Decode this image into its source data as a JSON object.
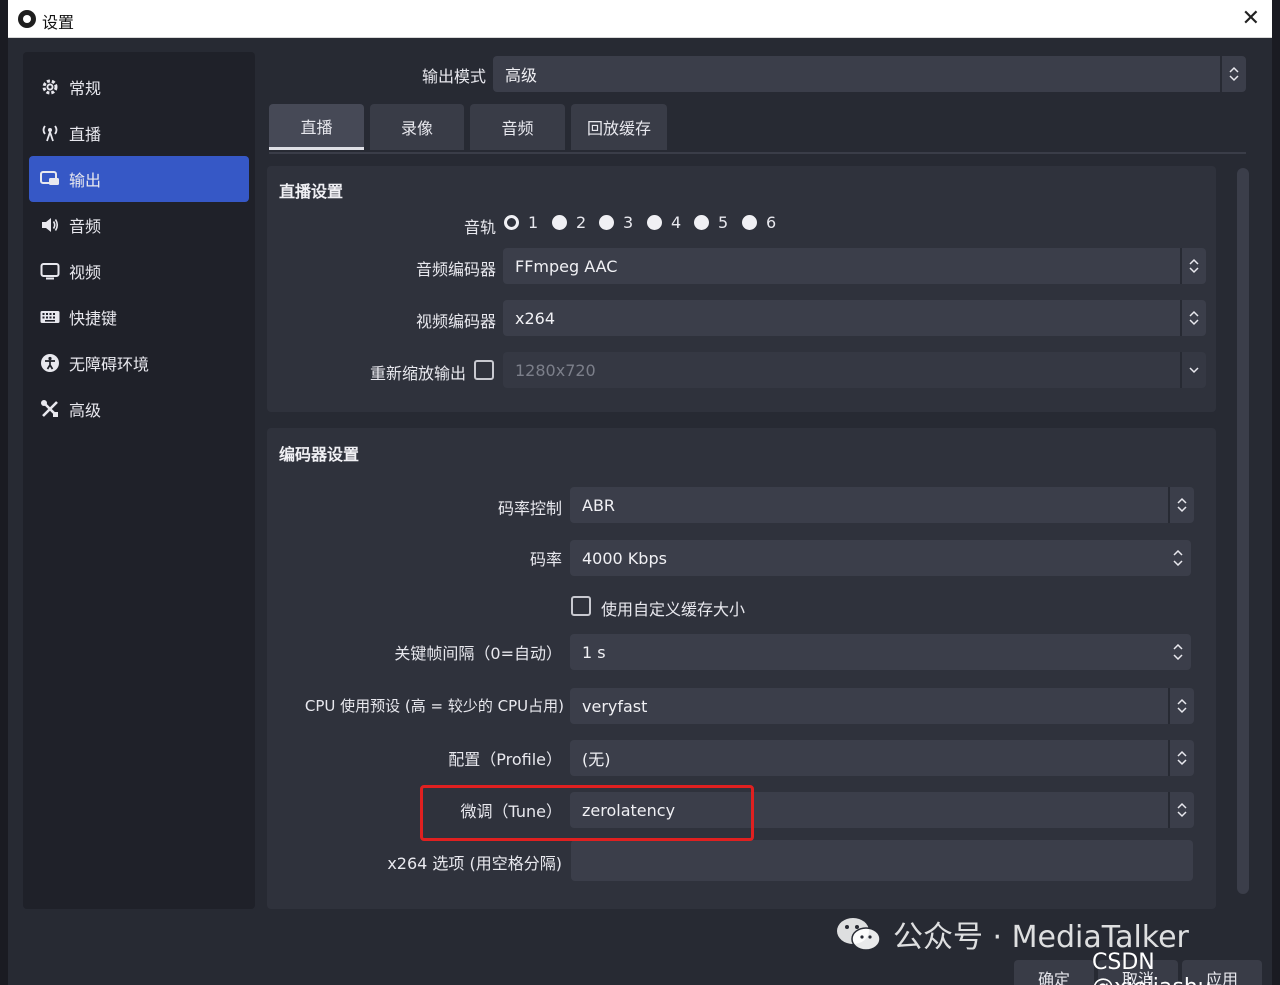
{
  "window": {
    "title": "设置"
  },
  "sidebar": {
    "items": [
      {
        "label": "常规",
        "icon": "gear-icon"
      },
      {
        "label": "直播",
        "icon": "broadcast-icon"
      },
      {
        "label": "输出",
        "icon": "output-icon",
        "active": true
      },
      {
        "label": "音频",
        "icon": "speaker-icon"
      },
      {
        "label": "视频",
        "icon": "monitor-icon"
      },
      {
        "label": "快捷键",
        "icon": "keyboard-icon"
      },
      {
        "label": "无障碍环境",
        "icon": "accessibility-icon"
      },
      {
        "label": "高级",
        "icon": "wrench-icon"
      }
    ]
  },
  "output_mode": {
    "label": "输出模式",
    "value": "高级"
  },
  "tabs": [
    "直播",
    "录像",
    "音频",
    "回放缓存"
  ],
  "stream_group": {
    "title": "直播设置",
    "audio_track_label": "音轨",
    "tracks": [
      "1",
      "2",
      "3",
      "4",
      "5",
      "6"
    ],
    "audio_encoder": {
      "label": "音频编码器",
      "value": "FFmpeg AAC"
    },
    "video_encoder": {
      "label": "视频编码器",
      "value": "x264"
    },
    "rescale": {
      "label": "重新缩放输出",
      "value": "1280x720"
    }
  },
  "encoder_group": {
    "title": "编码器设置",
    "rate_control": {
      "label": "码率控制",
      "value": "ABR"
    },
    "bitrate": {
      "label": "码率",
      "value": "4000 Kbps"
    },
    "custom_buffer": {
      "label": "使用自定义缓存大小"
    },
    "keyframe": {
      "label": "关键帧间隔（0=自动）",
      "value": "1 s"
    },
    "preset": {
      "label": "CPU 使用预设 (高 = 较少的 CPU占用)",
      "value": "veryfast"
    },
    "profile": {
      "label": "配置（Profile）",
      "value": "(无)"
    },
    "tune": {
      "label": "微调（Tune）",
      "value": "zerolatency"
    },
    "x264_options": {
      "label": "x264 选项 (用空格分隔)",
      "value": ""
    }
  },
  "buttons": {
    "ok": "确定",
    "cancel": "取消",
    "apply": "应用"
  },
  "watermark": {
    "text": "公众号 · MediaTalker",
    "credit": "CSDN @xiejiashu"
  },
  "colors": {
    "accent": "#3658c6",
    "highlight": "#e02020"
  }
}
